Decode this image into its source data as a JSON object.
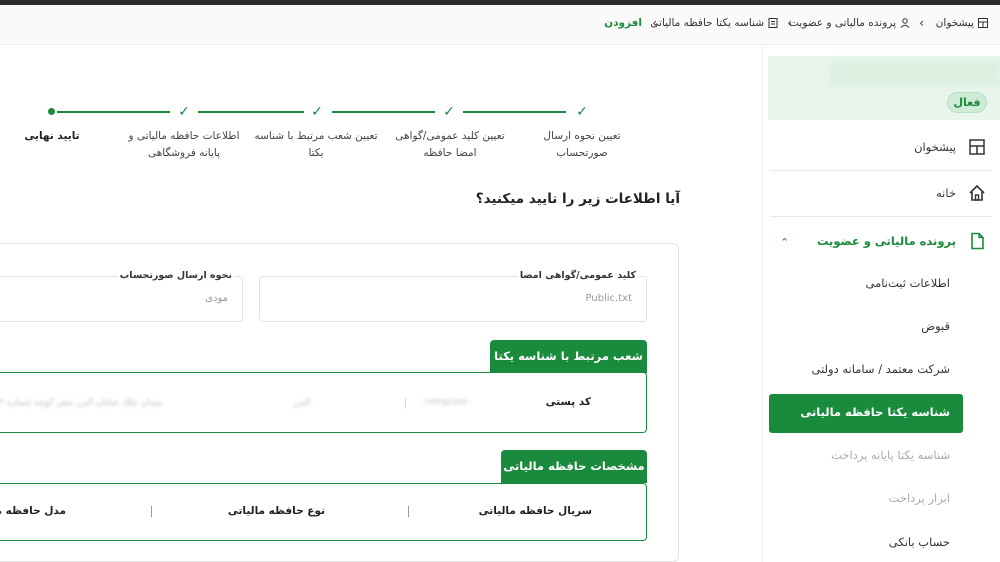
{
  "breadcrumb": {
    "items": [
      "پیشخوان",
      "پرونده مالیاتی و عضویت",
      "شناسه یکتا حافظه مالیاتی",
      "افزودن"
    ]
  },
  "stepper": {
    "steps": [
      {
        "label_line1": "تعیین نحوه ارسال",
        "label_line2": "صورتحساب",
        "state": "done"
      },
      {
        "label_line1": "تعیین کلید عمومی/گواهی",
        "label_line2": "امضا حافظه",
        "state": "done"
      },
      {
        "label_line1": "تعیین شعب مرتبط با شناسه",
        "label_line2": "یکتا",
        "state": "done"
      },
      {
        "label_line1": "اطلاعات حافظه مالیاتی و",
        "label_line2": "پایانه فروشگاهی",
        "state": "done"
      },
      {
        "label_line1": "تایید نهایی",
        "label_line2": "",
        "state": "current"
      }
    ]
  },
  "question": "آیا اطلاعات زیر را تایید میکنید؟",
  "fields": {
    "public_key_label": "کلید عمومی/گواهی امضا",
    "public_key_value": "Public.txt",
    "invoice_method_label": "نحوه ارسال صورتحساب",
    "invoice_method_value": "مودی"
  },
  "branches_section": {
    "title": "شعب مرتبط با شناسه یکتا",
    "postal_code_label": "کد پستی",
    "blurred_1": "۱۲۳۴۵۶۷۸۹۰",
    "blurred_2": "البرز",
    "blurred_3": "میدان ملک خیابان البرز نبش کوچه شماره ۳"
  },
  "memory_section": {
    "title": "مشخصات حافظه مالیاتی",
    "col_serial": "سریال حافظه مالیاتی",
    "col_type": "نوع حافظه مالیاتی",
    "col_model": "مدل حافظه مالیاتی"
  },
  "sidebar": {
    "status_badge": "فعال",
    "items": [
      {
        "label": "پیشخوان",
        "icon": "dashboard-icon"
      },
      {
        "label": "خانه",
        "icon": "home-icon"
      },
      {
        "label": "پرونده مالیاتی و عضویت",
        "icon": "file-icon"
      },
      {
        "label": "اطلاعات ثبت‌نامی"
      },
      {
        "label": "قبوض"
      },
      {
        "label": "شرکت معتمد / سامانه دولتی"
      },
      {
        "label": "شناسه یکتا حافظه مالیاتی"
      },
      {
        "label": "شناسه یکتا پایانه پرداخت"
      },
      {
        "label": "ابزار پرداخت"
      },
      {
        "label": "حساب بانکی"
      }
    ]
  },
  "colors": {
    "accent": "#1a8a3c"
  }
}
